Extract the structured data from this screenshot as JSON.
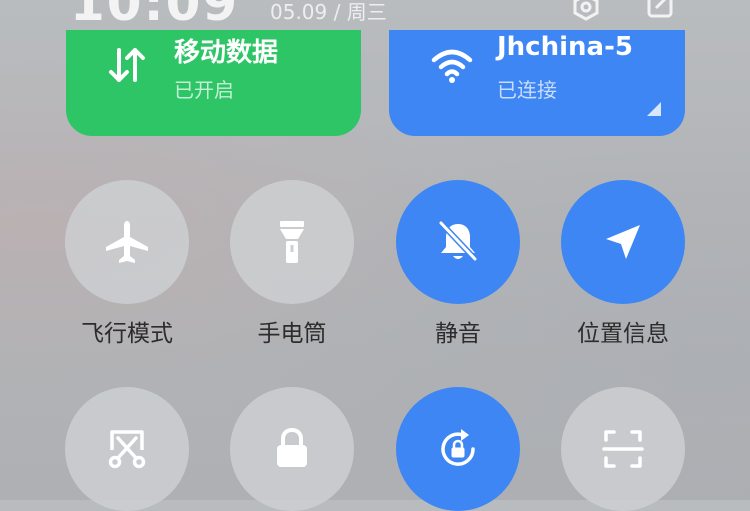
{
  "status_bar": {
    "time": "10:09",
    "date": "05.09 / 周三"
  },
  "tiles": {
    "mobile_data": {
      "title": "移动数据",
      "status": "已开启",
      "color": "#2ec567",
      "icon": "data-transfer-icon"
    },
    "wifi": {
      "title": "Jhchina-5",
      "status": "已连接",
      "color": "#3d86f4",
      "icon": "wifi-icon"
    }
  },
  "toggles": [
    {
      "label": "飞行模式",
      "state": "off",
      "icon": "airplane-icon"
    },
    {
      "label": "手电筒",
      "state": "off",
      "icon": "flashlight-icon"
    },
    {
      "label": "静音",
      "state": "on",
      "icon": "bell-muted-icon"
    },
    {
      "label": "位置信息",
      "state": "on",
      "icon": "location-arrow-icon"
    },
    {
      "label": "",
      "state": "off",
      "icon": "screenshot-scissors-icon"
    },
    {
      "label": "",
      "state": "off",
      "icon": "lock-icon"
    },
    {
      "label": "",
      "state": "on",
      "icon": "rotation-lock-icon"
    },
    {
      "label": "",
      "state": "off",
      "icon": "scan-icon"
    }
  ],
  "colors": {
    "active": "#3d86f4",
    "inactive": "#cdcfd1",
    "label_text": "#2c2c2c"
  }
}
